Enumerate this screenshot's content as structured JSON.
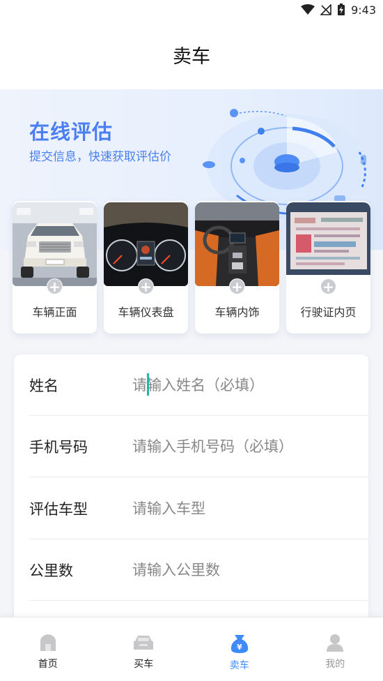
{
  "status_bar": {
    "time": "9:43"
  },
  "header": {
    "title": "卖车"
  },
  "banner": {
    "title": "在线评估",
    "subtitle": "提交信息，快速获取评估价"
  },
  "photos": [
    {
      "label": "车辆正面"
    },
    {
      "label": "车辆仪表盘"
    },
    {
      "label": "车辆内饰"
    },
    {
      "label": "行驶证内页"
    }
  ],
  "form": {
    "fields": [
      {
        "label": "姓名",
        "placeholder": "请输入姓名（必填）",
        "value": ""
      },
      {
        "label": "手机号码",
        "placeholder": "请输入手机号码（必填）",
        "value": ""
      },
      {
        "label": "评估车型",
        "placeholder": "请输入车型",
        "value": ""
      },
      {
        "label": "公里数",
        "placeholder": "请输入公里数",
        "value": ""
      }
    ]
  },
  "nav": {
    "items": [
      {
        "label": "首页",
        "icon": "home-icon"
      },
      {
        "label": "买车",
        "icon": "car-icon"
      },
      {
        "label": "卖车",
        "icon": "money-bag-icon",
        "active": true
      },
      {
        "label": "我的",
        "icon": "user-icon"
      }
    ]
  },
  "colors": {
    "accent": "#3f8aff",
    "banner_text": "#4a7ff2",
    "caret": "#21b7a8"
  }
}
